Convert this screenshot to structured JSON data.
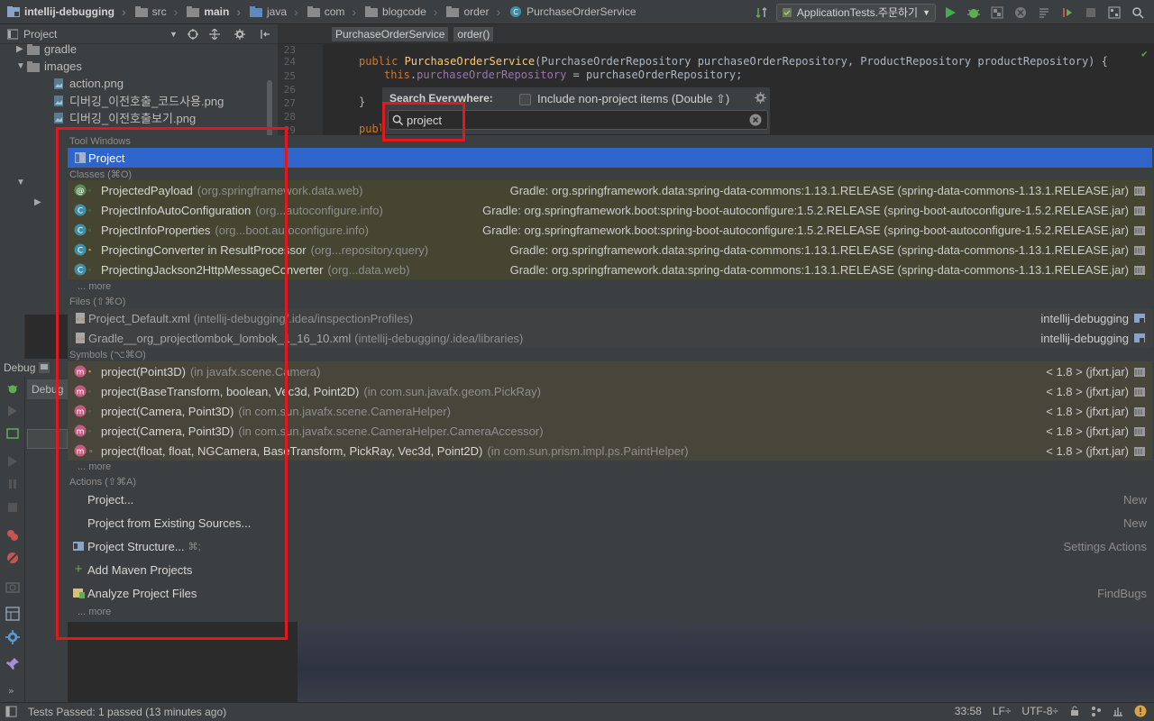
{
  "navbar": {
    "breadcrumbs": [
      "intellij-debugging",
      "src",
      "main",
      "java",
      "com",
      "blogcode",
      "order",
      "PurchaseOrderService"
    ],
    "run_config": "ApplicationTests.주문하기"
  },
  "project_panel": {
    "title": "Project",
    "tree": [
      {
        "label": "gradle",
        "type": "folder"
      },
      {
        "label": "images",
        "type": "folder"
      },
      {
        "label": "action.png",
        "type": "image"
      },
      {
        "label": "디버깅_이전호출_코드사용.png",
        "type": "image"
      },
      {
        "label": "디버깅_이전호출보기.png",
        "type": "image"
      }
    ]
  },
  "editor": {
    "breadcrumbs": [
      "PurchaseOrderService",
      "order()"
    ],
    "line_numbers": [
      "23",
      "24",
      "25",
      "26",
      "27",
      "28",
      "29"
    ],
    "lines": {
      "l24_kw": "public ",
      "l24_fn": "PurchaseOrderService",
      "l24_rest": "(PurchaseOrderRepository purchaseOrderRepository, ProductRepository productRepository) {",
      "l25_kw": "this",
      "l25_dot": ".",
      "l25_fld": "purchaseOrderRepository",
      "l25_rest": " = purchaseOrderRepository;",
      "l27": "}",
      "l29_kw": "publ"
    }
  },
  "search": {
    "title": "Search Everywhere:",
    "include_label": "Include non-project items (Double ⇧)",
    "query": "project"
  },
  "results": {
    "tool_windows_header": "Tool Windows",
    "tool_windows": [
      {
        "name": "Project"
      }
    ],
    "classes_header": "Classes (⌘O)",
    "classes": [
      {
        "name": "ProjectedPayload",
        "loc": "(org.springframework.data.web)",
        "source": "Gradle: org.springframework.data:spring-data-commons:1.13.1.RELEASE (spring-data-commons-1.13.1.RELEASE.jar)"
      },
      {
        "name": "ProjectInfoAutoConfiguration",
        "loc": "(org...autoconfigure.info)",
        "source": "Gradle: org.springframework.boot:spring-boot-autoconfigure:1.5.2.RELEASE (spring-boot-autoconfigure-1.5.2.RELEASE.jar)"
      },
      {
        "name": "ProjectInfoProperties",
        "loc": "(org...boot.autoconfigure.info)",
        "source": "Gradle: org.springframework.boot:spring-boot-autoconfigure:1.5.2.RELEASE (spring-boot-autoconfigure-1.5.2.RELEASE.jar)"
      },
      {
        "name": "ProjectingConverter in ResultProcessor",
        "loc": "(org...repository.query)",
        "source": "Gradle: org.springframework.data:spring-data-commons:1.13.1.RELEASE (spring-data-commons-1.13.1.RELEASE.jar)"
      },
      {
        "name": "ProjectingJackson2HttpMessageConverter",
        "loc": "(org...data.web)",
        "source": "Gradle: org.springframework.data:spring-data-commons:1.13.1.RELEASE (spring-data-commons-1.13.1.RELEASE.jar)"
      }
    ],
    "more_label": "... more",
    "files_header": "Files (⇧⌘O)",
    "files": [
      {
        "name": "Project_Default.xml",
        "loc": "(intellij-debugging/.idea/inspectionProfiles)",
        "source": "intellij-debugging"
      },
      {
        "name": "Gradle__org_projectlombok_lombok_1_16_10.xml",
        "loc": "(intellij-debugging/.idea/libraries)",
        "source": "intellij-debugging"
      }
    ],
    "symbols_header": "Symbols (⌥⌘O)",
    "symbols": [
      {
        "name": "project(Point3D)",
        "loc": "(in javafx.scene.Camera)",
        "source": "< 1.8 > (jfxrt.jar)"
      },
      {
        "name": "project(BaseTransform, boolean, Vec3d, Point2D)",
        "loc": "(in com.sun.javafx.geom.PickRay)",
        "source": "< 1.8 > (jfxrt.jar)"
      },
      {
        "name": "project(Camera, Point3D)",
        "loc": "(in com.sun.javafx.scene.CameraHelper)",
        "source": "< 1.8 > (jfxrt.jar)"
      },
      {
        "name": "project(Camera, Point3D)",
        "loc": "(in com.sun.javafx.scene.CameraHelper.CameraAccessor)",
        "source": "< 1.8 > (jfxrt.jar)"
      },
      {
        "name": "project(float, float, NGCamera, BaseTransform, PickRay, Vec3d, Point2D)",
        "loc": "(in com.sun.prism.impl.ps.PaintHelper)",
        "source": "< 1.8 > (jfxrt.jar)"
      }
    ],
    "actions_header": "Actions (⇧⌘A)",
    "actions": [
      {
        "name": "Project...",
        "shortcut": "",
        "category": "New"
      },
      {
        "name": "Project from Existing Sources...",
        "shortcut": "",
        "category": "New"
      },
      {
        "name": "Project Structure...",
        "shortcut": "⌘;",
        "category": "Settings Actions"
      },
      {
        "name": "Add Maven Projects",
        "shortcut": "",
        "category": ""
      },
      {
        "name": "Analyze Project Files",
        "shortcut": "",
        "category": "FindBugs"
      }
    ]
  },
  "debug_panel": {
    "label": "Debug",
    "tab": "Debug"
  },
  "status_bar": {
    "message": "Tests Passed: 1 passed (13 minutes ago)",
    "position": "33:58",
    "line_sep": "LF÷",
    "encoding": "UTF-8÷"
  },
  "colors": {
    "highlight": "#e0191e",
    "selection": "#2f65ca",
    "class_row": "#454531",
    "symbol_row": "#48453a"
  }
}
